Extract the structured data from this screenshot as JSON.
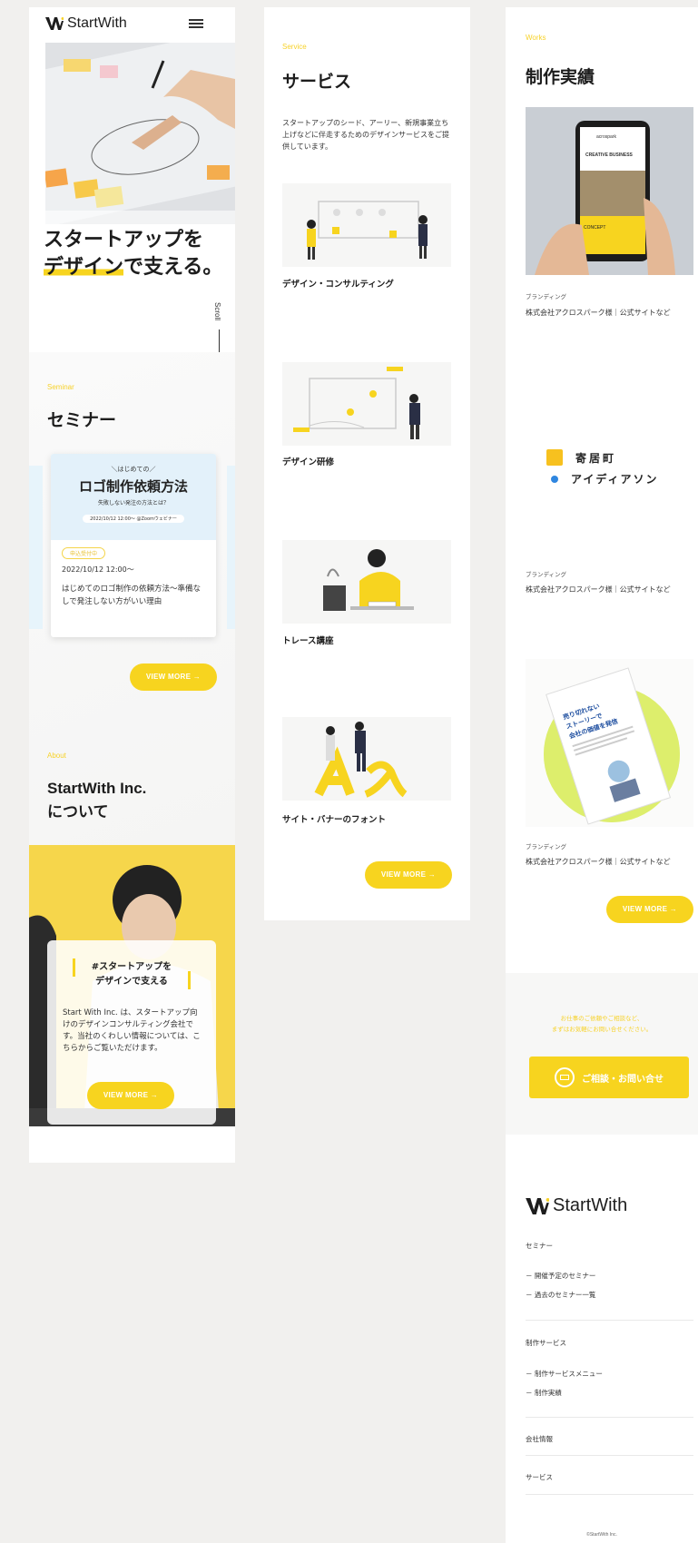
{
  "brand": {
    "name": "StartWith",
    "accent": "#f7d41f"
  },
  "col1": {
    "hero_line1": "スタートアップを",
    "hero_line2_highlight": "デザイン",
    "hero_line2_rest": "で支える。",
    "scroll_label": "Scroll",
    "seminar_en": "Seminar",
    "seminar_ja": "セミナー",
    "card": {
      "banner_small": "＼はじめての／",
      "banner_title": "ロゴ制作依頼方法",
      "banner_sub": "失敗しない発注の方法とは？",
      "banner_date": "2022/10/12 12:00〜 @Zoomウェビナー",
      "badge": "申込受付中",
      "date": "2022/10/12 12:00〜",
      "desc": "はじめてのロゴ制作の依頼方法〜準備なしで発注しない方がいい理由"
    },
    "view_more": "VIEW MORE →",
    "about_en": "About",
    "about_title_1": "StartWith Inc.",
    "about_title_2": "について",
    "about_card_title_1": "#スタートアップを",
    "about_card_title_2": "デザインで支える",
    "about_card_text": "Start With Inc. は、スタートアップ向けのデザインコンサルティング会社です。当社のくわしい情報については、こちらからご覧いただけます。",
    "about_view_more": "VIEW MORE →"
  },
  "col2": {
    "service_en": "Service",
    "service_ja": "サービス",
    "intro": "スタートアップのシード、アーリー、新規事業立ち上げなどに伴走するためのデザインサービスをご提供しています。",
    "services": [
      {
        "label": "デザイン・コンサルティング"
      },
      {
        "label": "デザイン研修"
      },
      {
        "label": "トレース講座"
      },
      {
        "label": "サイト・バナーのフォント"
      }
    ],
    "view_more": "VIEW MORE →"
  },
  "col3": {
    "works_en": "Works",
    "works_ja": "制作実績",
    "works": [
      {
        "category": "ブランディング",
        "title": "株式会社アクロスパーク様｜公式サイトなど"
      },
      {
        "category": "ブランディング",
        "title": "株式会社アクロスパーク様｜公式サイトなど"
      },
      {
        "category": "ブランディング",
        "title": "株式会社アクロスパーク様｜公式サイトなど"
      }
    ],
    "phone": {
      "brand": "acrospark",
      "headline": "CREATIVE BUSINESS",
      "sub": "CONCEPT"
    },
    "logo_card": {
      "line1": "寄居町",
      "line2": "アイディアソン"
    },
    "book": {
      "line1": "売り切れない",
      "line2": "ストーリーで",
      "line3": "会社の価値を発信"
    },
    "view_more": "VIEW MORE →",
    "contact_note_1": "お仕事のご依頼やご相談など、",
    "contact_note_2": "まずはお気軽にお問い合せください。",
    "contact_button": "ご相談・お問い合せ",
    "footer": {
      "seminar": "セミナー",
      "seminar_upcoming": "－ 開催予定のセミナー",
      "seminar_past": "－ 過去のセミナー一覧",
      "works_service": "制作サービス",
      "works_menu": "－ 制作サービスメニュー",
      "works_results": "－ 制作実績",
      "company": "会社情報",
      "service": "サービス",
      "copyright": "©StartWith Inc."
    }
  }
}
